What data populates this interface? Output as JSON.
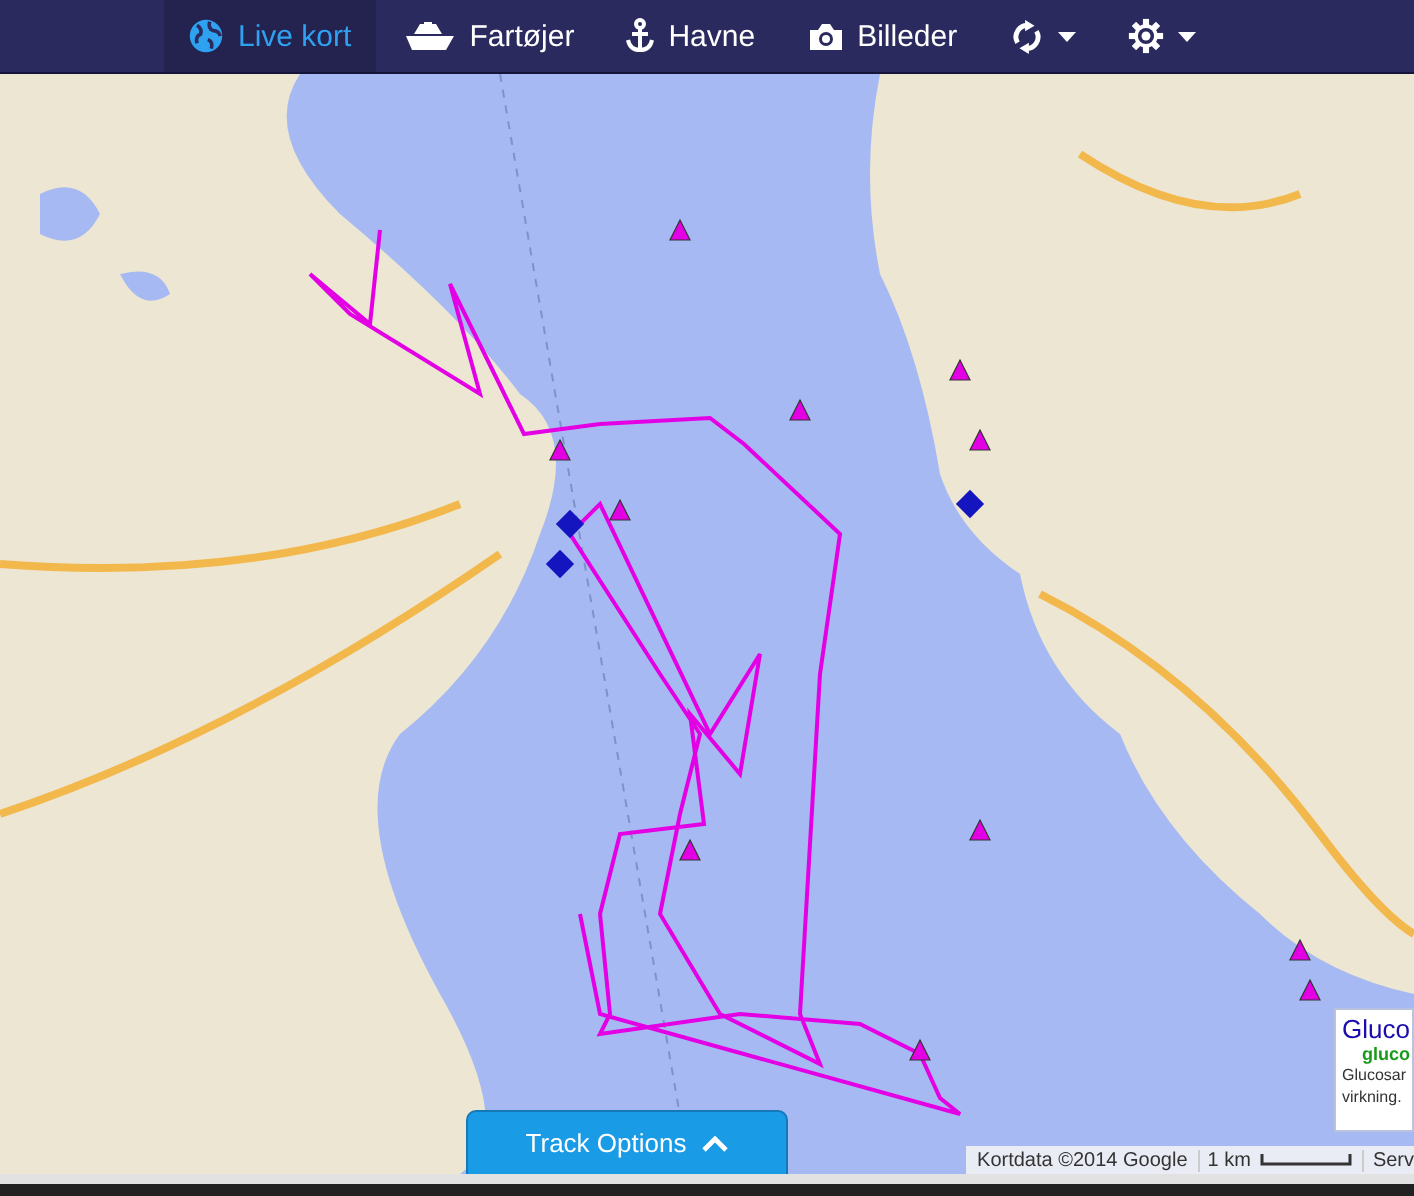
{
  "navbar": {
    "items": [
      {
        "kind": "globe",
        "label": "Live kort",
        "selected": true,
        "dropdown": false
      },
      {
        "kind": "ship",
        "label": "Fartøjer",
        "selected": false,
        "dropdown": false
      },
      {
        "kind": "anchor",
        "label": "Havne",
        "selected": false,
        "dropdown": false
      },
      {
        "kind": "camera",
        "label": "Billeder",
        "selected": false,
        "dropdown": false
      },
      {
        "kind": "refresh",
        "selected": false,
        "dropdown": true
      },
      {
        "kind": "gear",
        "selected": false,
        "dropdown": true
      }
    ]
  },
  "map": {
    "attribution": "Kortdata ©2014 Google",
    "scale": "1 km",
    "terms": "Serv",
    "ad": {
      "title": "Gluco",
      "url": "gluco",
      "text": "Glucosar virkning."
    }
  },
  "track_options": {
    "label": "Track Options",
    "expanded": false
  }
}
